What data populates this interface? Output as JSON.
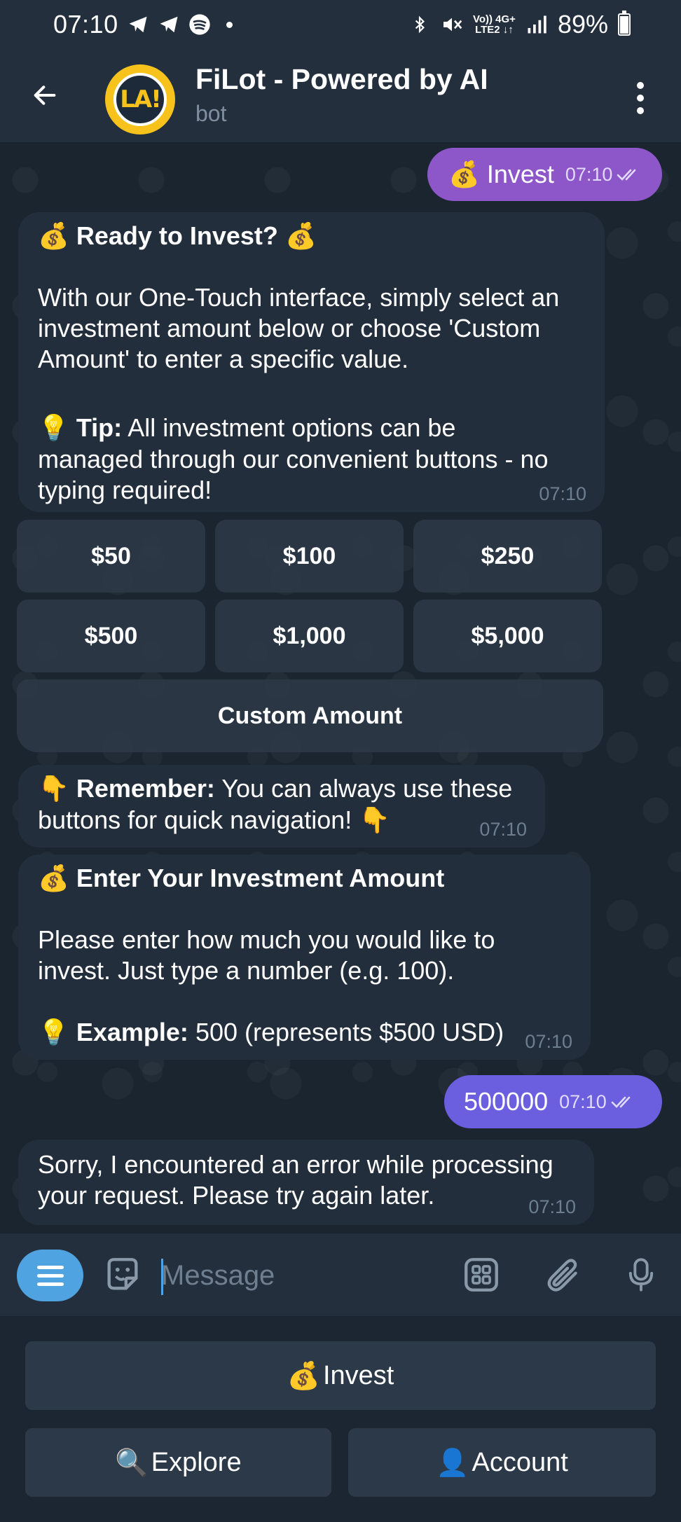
{
  "status_bar": {
    "time": "07:10",
    "network_top": "Vo)) 4G+",
    "network_bottom": "LTE2 ↓↑",
    "battery_percent": "89%",
    "battery_level": 0.89
  },
  "header": {
    "title": "FiLot - Powered by AI",
    "subtitle": "bot",
    "avatar_text": "LA!"
  },
  "messages": {
    "m1": {
      "text": "💰 Invest",
      "time": "07:10",
      "color": "#8e57c9"
    },
    "m2": {
      "title_emoji": "💰",
      "title": "Ready to Invest?",
      "title_emoji_end": "💰",
      "line1": "With our One-Touch interface, simply select an",
      "line2": "investment amount below or choose 'Custom",
      "line3": "Amount' to enter a specific value.",
      "tip_emoji": "💡",
      "tip_label": "Tip:",
      "tip_line1": "All investment options can be",
      "tip_line2": "managed through our convenient buttons - no",
      "tip_line3": "typing required!",
      "time": "07:10"
    },
    "inline_keyboard": {
      "row1": [
        "$50",
        "$100",
        "$250"
      ],
      "row2": [
        "$500",
        "$1,000",
        "$5,000"
      ],
      "custom": "Custom Amount"
    },
    "m3": {
      "emoji": "👇",
      "label": "Remember:",
      "line1": "You can always use these",
      "line2": "buttons for quick navigation!",
      "emoji_end": "👇",
      "time": "07:10"
    },
    "m4": {
      "title_emoji": "💰",
      "title": "Enter Your Investment Amount",
      "line1": "Please enter how much you would like to",
      "line2": "invest. Just type a number (e.g. 100).",
      "example_emoji": "💡",
      "example_label": "Example:",
      "example_text": "500 (represents $500 USD)",
      "time": "07:10"
    },
    "m5": {
      "text": "500000",
      "time": "07:10",
      "color": "#6b5fe0"
    },
    "m6": {
      "line1": "Sorry, I encountered an error while processing",
      "line2": "your request. Please try again later.",
      "time": "07:10"
    }
  },
  "input": {
    "placeholder": "Message"
  },
  "reply_keyboard": {
    "invest": {
      "emoji": "💰",
      "label": "Invest"
    },
    "explore": {
      "emoji": "🔍",
      "label": "Explore"
    },
    "account": {
      "emoji": "👤",
      "label": "Account"
    }
  },
  "colors": {
    "accent": "#4fa3e0",
    "bubble_in": "#232e3c",
    "header": "#232f3d"
  }
}
